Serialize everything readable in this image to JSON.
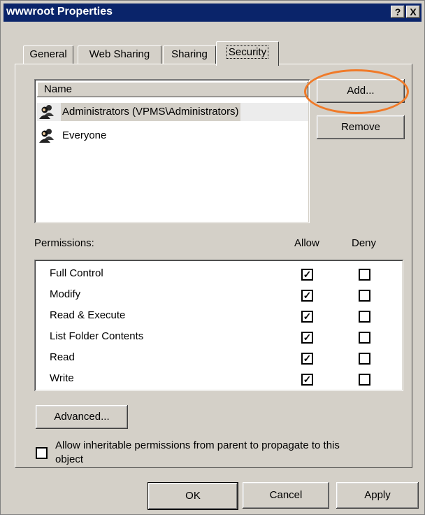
{
  "window": {
    "title": "wwwroot Properties",
    "help_button": "?",
    "close_button": "X"
  },
  "tabs": [
    {
      "label": "General"
    },
    {
      "label": "Web Sharing"
    },
    {
      "label": "Sharing"
    },
    {
      "label": "Security",
      "active": true
    }
  ],
  "users": {
    "header": "Name",
    "items": [
      {
        "label": "Administrators (VPMS\\Administrators)",
        "selected": true
      },
      {
        "label": "Everyone",
        "selected": false
      }
    ],
    "add_label": "Add...",
    "remove_label": "Remove"
  },
  "permissions": {
    "label": "Permissions:",
    "allow_header": "Allow",
    "deny_header": "Deny",
    "rows": [
      {
        "name": "Full Control",
        "allow": true,
        "deny": false
      },
      {
        "name": "Modify",
        "allow": true,
        "deny": false
      },
      {
        "name": "Read & Execute",
        "allow": true,
        "deny": false
      },
      {
        "name": "List Folder Contents",
        "allow": true,
        "deny": false
      },
      {
        "name": "Read",
        "allow": true,
        "deny": false
      },
      {
        "name": "Write",
        "allow": true,
        "deny": false
      }
    ]
  },
  "advanced_label": "Advanced...",
  "inherit": {
    "line1": "Allow inheritable permissions from parent to propagate to this",
    "line2": "object",
    "checked": false
  },
  "footer": {
    "ok_label": "OK",
    "cancel_label": "Cancel",
    "apply_label": "Apply"
  },
  "colors": {
    "titlebar": "#0a246a",
    "dialog_face": "#d4d0c8",
    "highlight_oval": "#f07a28"
  }
}
